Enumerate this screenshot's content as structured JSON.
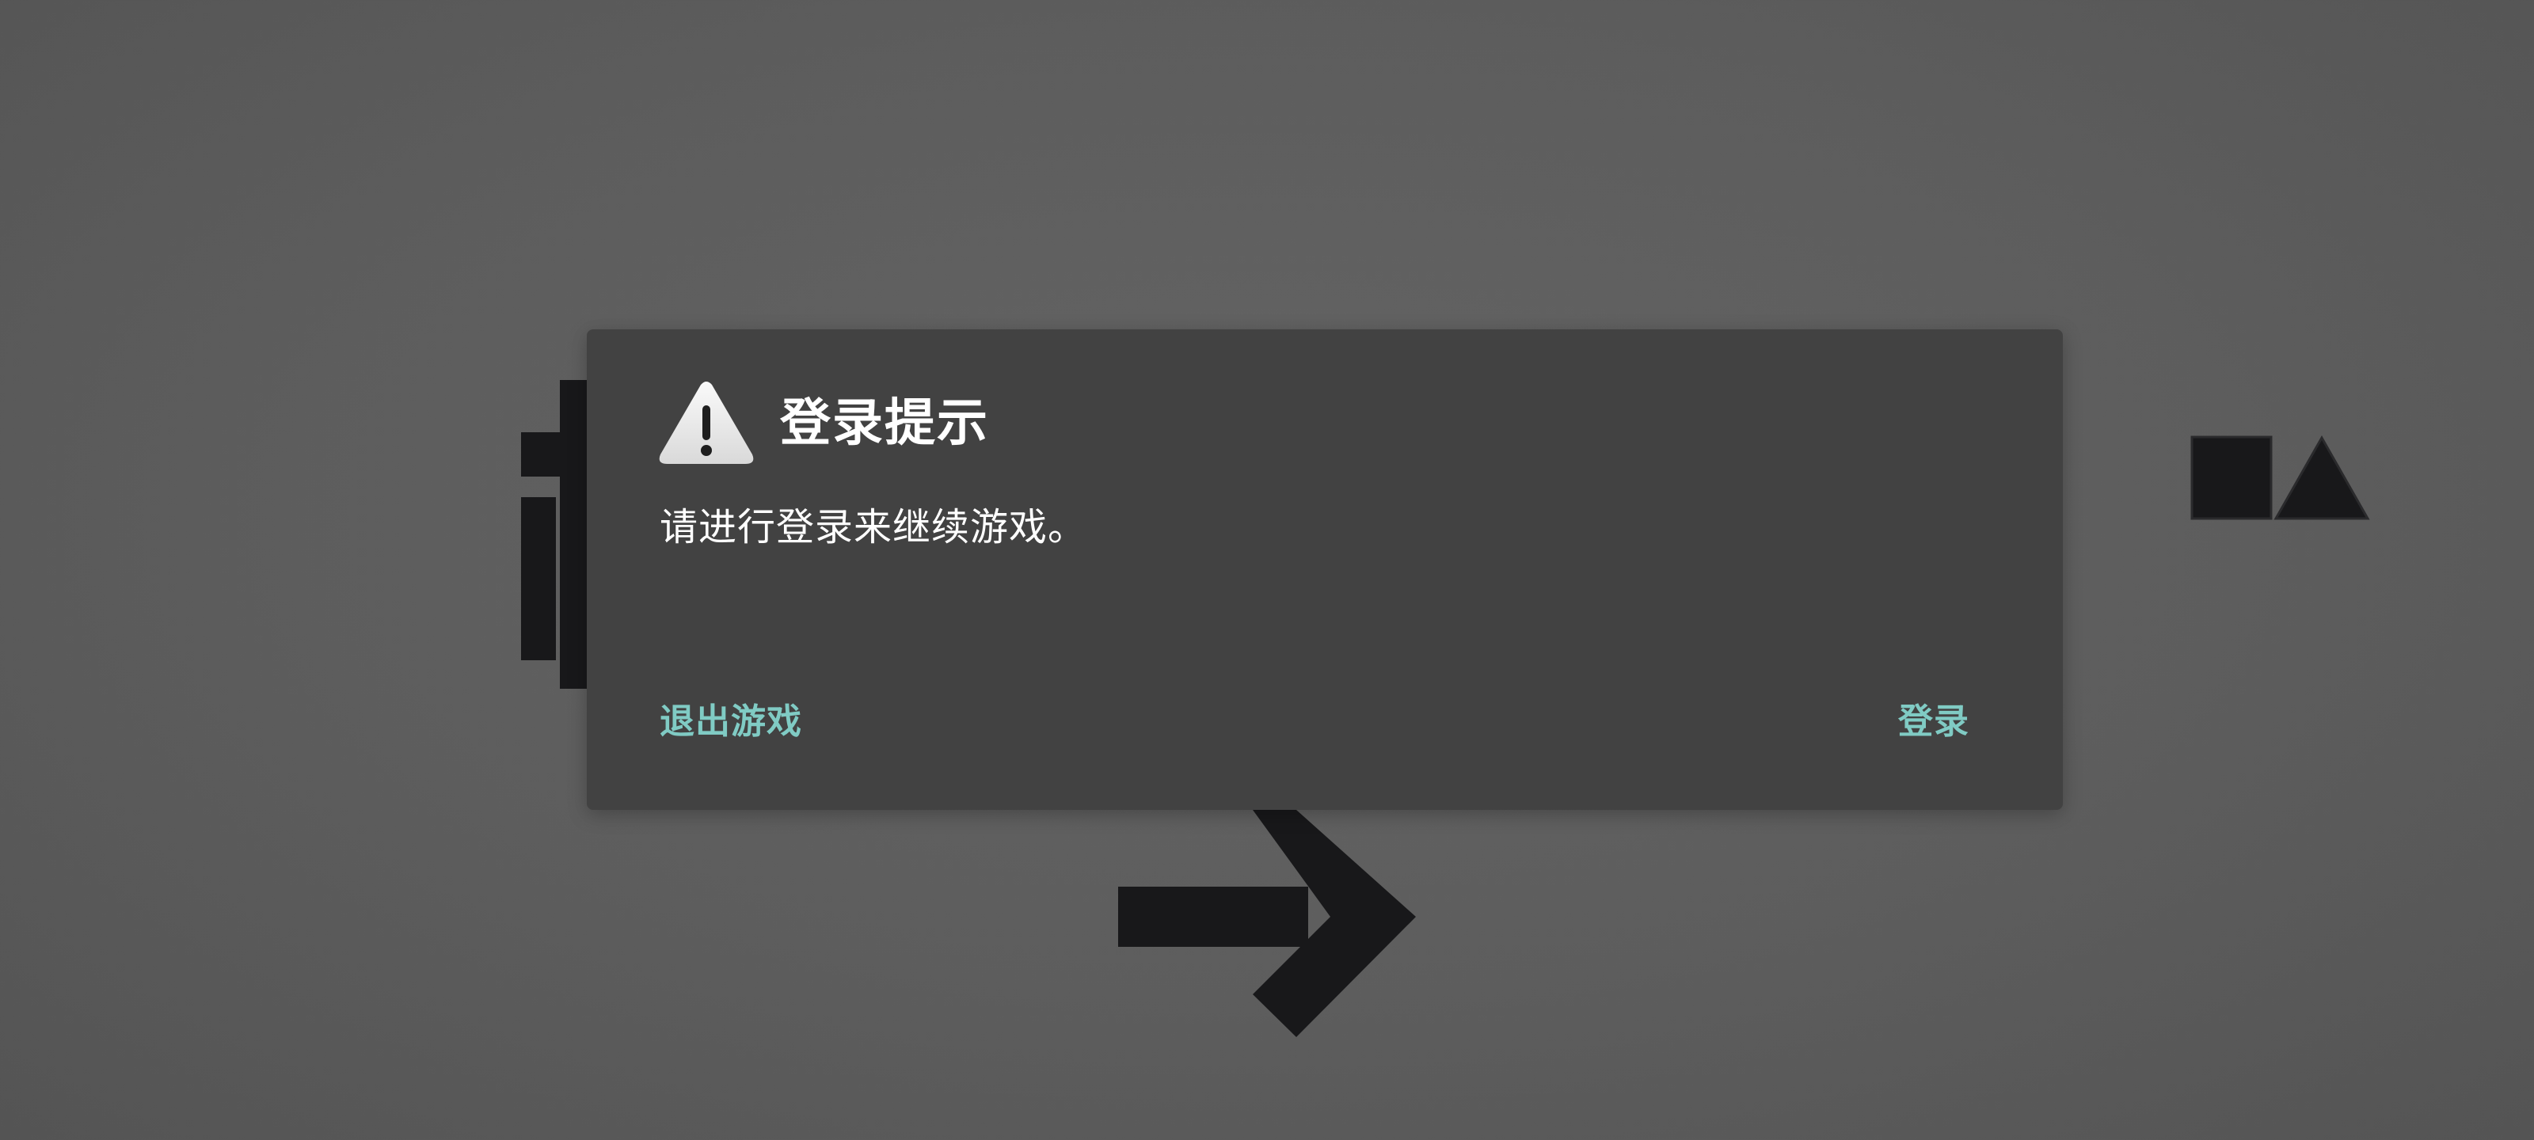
{
  "dialog": {
    "title": "登录提示",
    "message": "请进行登录来继续游戏。",
    "exit_label": "退出游戏",
    "login_label": "登录",
    "icon": "warning-icon"
  },
  "colors": {
    "background": "#5e5e5e",
    "dialog_background": "#424242",
    "title_text": "#ffffff",
    "button_text": "#80cbc4",
    "game_shapes": "#18181a"
  },
  "game_icons": [
    "pause-bars-icon",
    "right-arrow-icon",
    "square-triangle-icon"
  ]
}
